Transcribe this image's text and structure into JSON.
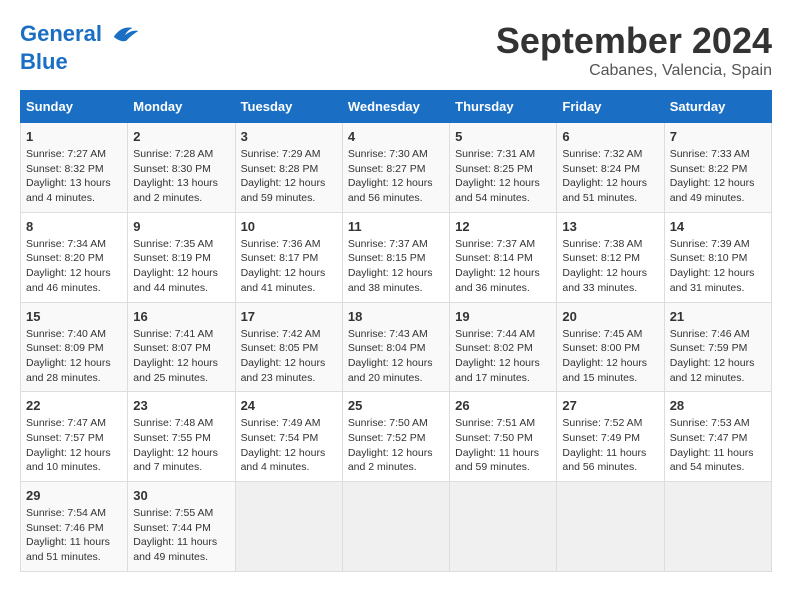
{
  "header": {
    "logo_line1": "General",
    "logo_line2": "Blue",
    "month_title": "September 2024",
    "location": "Cabanes, Valencia, Spain"
  },
  "weekdays": [
    "Sunday",
    "Monday",
    "Tuesday",
    "Wednesday",
    "Thursday",
    "Friday",
    "Saturday"
  ],
  "weeks": [
    [
      {
        "day": "1",
        "sunrise": "7:27 AM",
        "sunset": "8:32 PM",
        "daylight": "13 hours and 4 minutes."
      },
      {
        "day": "2",
        "sunrise": "7:28 AM",
        "sunset": "8:30 PM",
        "daylight": "13 hours and 2 minutes."
      },
      {
        "day": "3",
        "sunrise": "7:29 AM",
        "sunset": "8:28 PM",
        "daylight": "12 hours and 59 minutes."
      },
      {
        "day": "4",
        "sunrise": "7:30 AM",
        "sunset": "8:27 PM",
        "daylight": "12 hours and 56 minutes."
      },
      {
        "day": "5",
        "sunrise": "7:31 AM",
        "sunset": "8:25 PM",
        "daylight": "12 hours and 54 minutes."
      },
      {
        "day": "6",
        "sunrise": "7:32 AM",
        "sunset": "8:24 PM",
        "daylight": "12 hours and 51 minutes."
      },
      {
        "day": "7",
        "sunrise": "7:33 AM",
        "sunset": "8:22 PM",
        "daylight": "12 hours and 49 minutes."
      }
    ],
    [
      {
        "day": "8",
        "sunrise": "7:34 AM",
        "sunset": "8:20 PM",
        "daylight": "12 hours and 46 minutes."
      },
      {
        "day": "9",
        "sunrise": "7:35 AM",
        "sunset": "8:19 PM",
        "daylight": "12 hours and 44 minutes."
      },
      {
        "day": "10",
        "sunrise": "7:36 AM",
        "sunset": "8:17 PM",
        "daylight": "12 hours and 41 minutes."
      },
      {
        "day": "11",
        "sunrise": "7:37 AM",
        "sunset": "8:15 PM",
        "daylight": "12 hours and 38 minutes."
      },
      {
        "day": "12",
        "sunrise": "7:37 AM",
        "sunset": "8:14 PM",
        "daylight": "12 hours and 36 minutes."
      },
      {
        "day": "13",
        "sunrise": "7:38 AM",
        "sunset": "8:12 PM",
        "daylight": "12 hours and 33 minutes."
      },
      {
        "day": "14",
        "sunrise": "7:39 AM",
        "sunset": "8:10 PM",
        "daylight": "12 hours and 31 minutes."
      }
    ],
    [
      {
        "day": "15",
        "sunrise": "7:40 AM",
        "sunset": "8:09 PM",
        "daylight": "12 hours and 28 minutes."
      },
      {
        "day": "16",
        "sunrise": "7:41 AM",
        "sunset": "8:07 PM",
        "daylight": "12 hours and 25 minutes."
      },
      {
        "day": "17",
        "sunrise": "7:42 AM",
        "sunset": "8:05 PM",
        "daylight": "12 hours and 23 minutes."
      },
      {
        "day": "18",
        "sunrise": "7:43 AM",
        "sunset": "8:04 PM",
        "daylight": "12 hours and 20 minutes."
      },
      {
        "day": "19",
        "sunrise": "7:44 AM",
        "sunset": "8:02 PM",
        "daylight": "12 hours and 17 minutes."
      },
      {
        "day": "20",
        "sunrise": "7:45 AM",
        "sunset": "8:00 PM",
        "daylight": "12 hours and 15 minutes."
      },
      {
        "day": "21",
        "sunrise": "7:46 AM",
        "sunset": "7:59 PM",
        "daylight": "12 hours and 12 minutes."
      }
    ],
    [
      {
        "day": "22",
        "sunrise": "7:47 AM",
        "sunset": "7:57 PM",
        "daylight": "12 hours and 10 minutes."
      },
      {
        "day": "23",
        "sunrise": "7:48 AM",
        "sunset": "7:55 PM",
        "daylight": "12 hours and 7 minutes."
      },
      {
        "day": "24",
        "sunrise": "7:49 AM",
        "sunset": "7:54 PM",
        "daylight": "12 hours and 4 minutes."
      },
      {
        "day": "25",
        "sunrise": "7:50 AM",
        "sunset": "7:52 PM",
        "daylight": "12 hours and 2 minutes."
      },
      {
        "day": "26",
        "sunrise": "7:51 AM",
        "sunset": "7:50 PM",
        "daylight": "11 hours and 59 minutes."
      },
      {
        "day": "27",
        "sunrise": "7:52 AM",
        "sunset": "7:49 PM",
        "daylight": "11 hours and 56 minutes."
      },
      {
        "day": "28",
        "sunrise": "7:53 AM",
        "sunset": "7:47 PM",
        "daylight": "11 hours and 54 minutes."
      }
    ],
    [
      {
        "day": "29",
        "sunrise": "7:54 AM",
        "sunset": "7:46 PM",
        "daylight": "11 hours and 51 minutes."
      },
      {
        "day": "30",
        "sunrise": "7:55 AM",
        "sunset": "7:44 PM",
        "daylight": "11 hours and 49 minutes."
      },
      null,
      null,
      null,
      null,
      null
    ]
  ]
}
